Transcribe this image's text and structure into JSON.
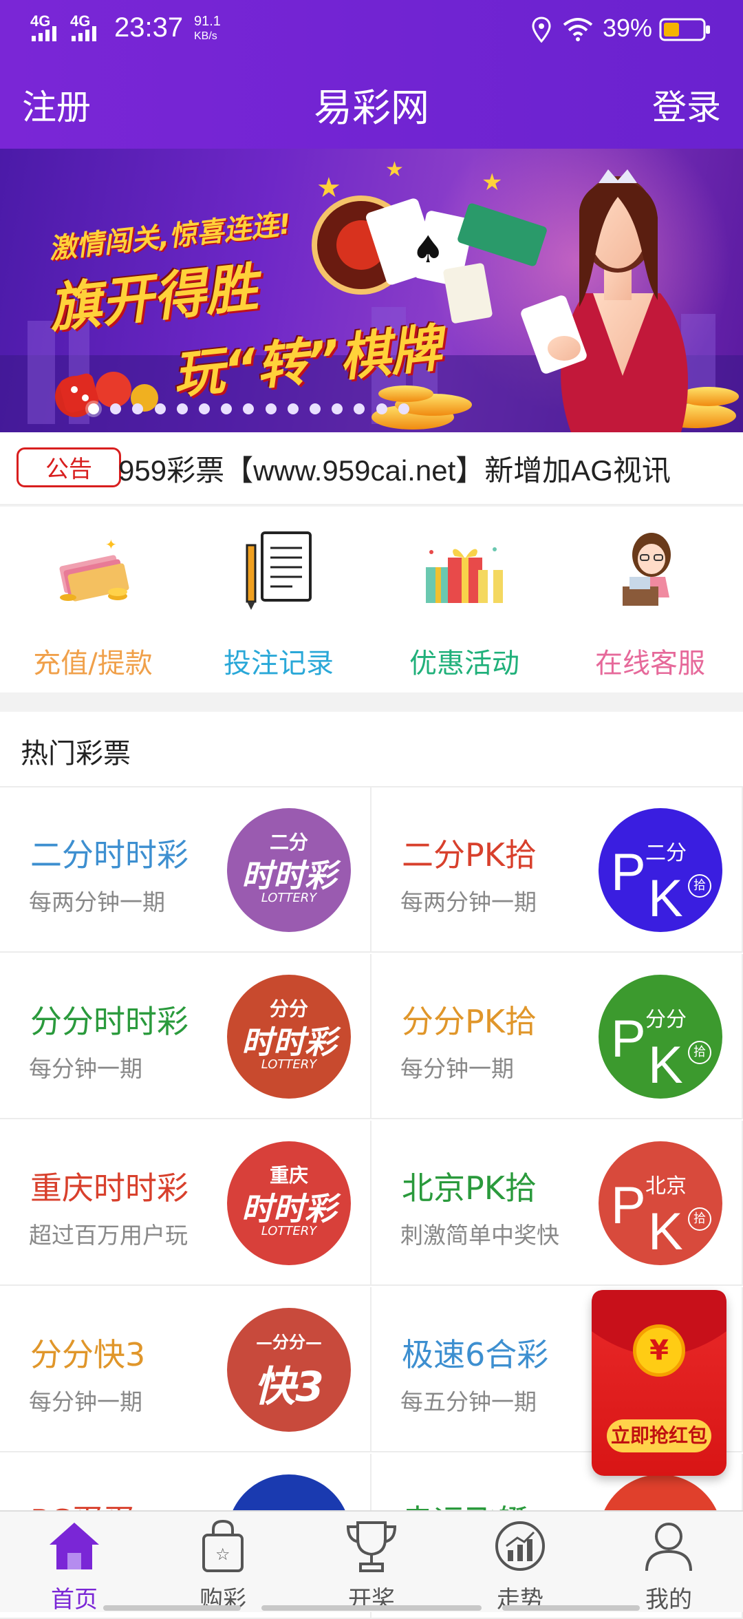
{
  "status": {
    "network1": "4G",
    "network2": "4G",
    "time": "23:37",
    "speed": "91.1",
    "speed_unit": "KB/s",
    "battery": "39%"
  },
  "header": {
    "title": "易彩网",
    "left": "注册",
    "right": "登录"
  },
  "banner": {
    "headline1": "激情闯关,惊喜连连!",
    "headline2": "旗开得胜",
    "headline3": "玩“转”棋牌",
    "dot_count": 15,
    "active_dot": 0
  },
  "notice": {
    "badge": "公告",
    "text": "959彩票【www.959cai.net】新增加AG视讯"
  },
  "quick": [
    {
      "label": "充值/提款",
      "color": "#f0a04a",
      "icon": "money-stack-icon"
    },
    {
      "label": "投注记录",
      "color": "#2aa8d8",
      "icon": "document-pencil-icon"
    },
    {
      "label": "优惠活动",
      "color": "#20b07a",
      "icon": "gift-boxes-icon"
    },
    {
      "label": "在线客服",
      "color": "#e6699a",
      "icon": "customer-service-icon"
    }
  ],
  "hot": {
    "title": "热门彩票",
    "items": [
      {
        "name": "二分时时彩",
        "sub": "每两分钟一期",
        "color": "#3d8fd0",
        "logo": "ssc",
        "logo_top": "二分",
        "logo_main": "时时彩",
        "logo_sub": "LOTTERY",
        "logo_bg": "#9a5bb0"
      },
      {
        "name": "二分PK拾",
        "sub": "每两分钟一期",
        "color": "#d8402c",
        "logo": "pk",
        "logo_top": "二分",
        "logo_ten": "拾",
        "logo_bg": "#3a1ee0"
      },
      {
        "name": "分分时时彩",
        "sub": "每分钟一期",
        "color": "#2a9a3c",
        "logo": "ssc",
        "logo_top": "分分",
        "logo_main": "时时彩",
        "logo_sub": "LOTTERY",
        "logo_bg": "#c84a2e"
      },
      {
        "name": "分分PK拾",
        "sub": "每分钟一期",
        "color": "#e0962a",
        "logo": "pk",
        "logo_top": "分分",
        "logo_ten": "拾",
        "logo_bg": "#3c9a2e"
      },
      {
        "name": "重庆时时彩",
        "sub": "超过百万用户玩",
        "color": "#d8402c",
        "logo": "ssc",
        "logo_top": "重庆",
        "logo_main": "时时彩",
        "logo_sub": "LOTTERY",
        "logo_bg": "#d8403a"
      },
      {
        "name": "北京PK拾",
        "sub": "刺激简单中奖快",
        "color": "#2a9a3c",
        "logo": "pk",
        "logo_top": "北京",
        "logo_ten": "拾",
        "logo_bg": "#d84a3c"
      },
      {
        "name": "分分快3",
        "sub": "每分钟一期",
        "color": "#e0962a",
        "logo": "k3",
        "logo_top": "—分分—",
        "logo_main": "快3",
        "logo_bg": "#c84a3c"
      },
      {
        "name": "极速6合彩",
        "sub": "每五分钟一期",
        "color": "#3d8fd0",
        "logo": "none"
      },
      {
        "name": "PC蛋蛋",
        "sub": "",
        "color": "#d8402c",
        "logo": "partial",
        "logo_bg": "#1a3ab0"
      },
      {
        "name": "幸运飞艇",
        "sub": "",
        "color": "#2a9a3c",
        "logo": "partial",
        "logo_bg": "#e0402c"
      }
    ]
  },
  "redpacket": {
    "coin": "¥",
    "button": "立即抢红包"
  },
  "nav": [
    {
      "label": "首页",
      "icon": "home-icon",
      "active": true
    },
    {
      "label": "购彩",
      "icon": "shopping-bag-icon",
      "active": false
    },
    {
      "label": "开奖",
      "icon": "trophy-icon",
      "active": false
    },
    {
      "label": "走势",
      "icon": "trend-chart-icon",
      "active": false
    },
    {
      "label": "我的",
      "icon": "user-icon",
      "active": false
    }
  ],
  "colors": {
    "brand": "#7a26d6",
    "notice_red": "#d81e1e"
  }
}
